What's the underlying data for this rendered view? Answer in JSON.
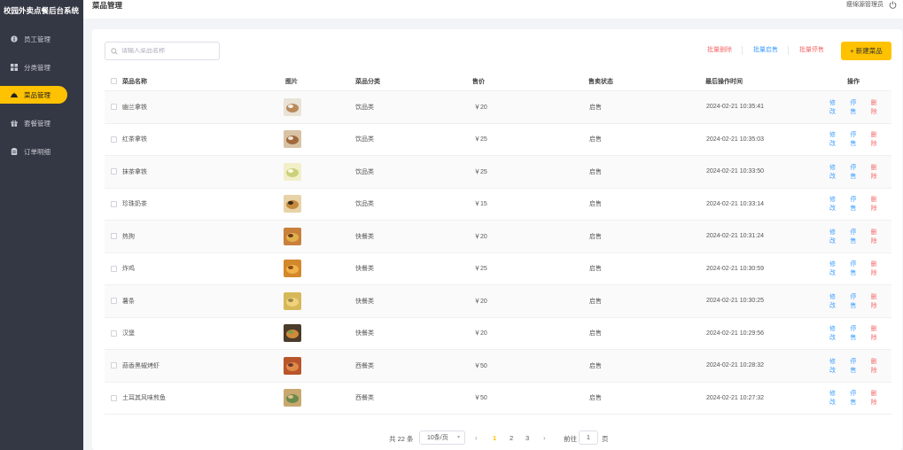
{
  "app": {
    "title": "校园外卖点餐后台系统"
  },
  "sidebar": {
    "items": [
      {
        "label": "员工管理",
        "icon": "info-circle-icon",
        "active": false
      },
      {
        "label": "分类管理",
        "icon": "grid-icon",
        "active": false
      },
      {
        "label": "菜品管理",
        "icon": "dish-cover-icon",
        "active": true
      },
      {
        "label": "套餐管理",
        "icon": "gift-box-icon",
        "active": false
      },
      {
        "label": "订单明细",
        "icon": "clipboard-icon",
        "active": false
      }
    ]
  },
  "header": {
    "title": "菜品管理",
    "user": "瘦绵源管理员",
    "logout_icon": "power-icon"
  },
  "toolbar": {
    "search_placeholder": "请输入菜品名称",
    "batch_delete": "批量删除",
    "batch_enable": "批量启售",
    "batch_disable": "批量停售",
    "new_dish": "+ 新建菜品"
  },
  "table": {
    "columns": [
      "菜品名称",
      "图片",
      "菜品分类",
      "售价",
      "售卖状态",
      "最后操作时间",
      "操作"
    ],
    "rows": [
      {
        "name": "幽兰拿铁",
        "category": "饮品类",
        "price": "￥20",
        "status": "启售",
        "updated": "2024-02-21 10:35:41",
        "edit": "修改",
        "stop": "停售",
        "delete": "删除"
      },
      {
        "name": "红茶拿铁",
        "category": "饮品类",
        "price": "￥25",
        "status": "启售",
        "updated": "2024-02-21 10:35:03",
        "edit": "修改",
        "stop": "停售",
        "delete": "删除"
      },
      {
        "name": "抹茶拿铁",
        "category": "饮品类",
        "price": "￥25",
        "status": "启售",
        "updated": "2024-02-21 10:33:50",
        "edit": "修改",
        "stop": "停售",
        "delete": "删除"
      },
      {
        "name": "珍珠奶茶",
        "category": "饮品类",
        "price": "￥15",
        "status": "启售",
        "updated": "2024-02-21 10:33:14",
        "edit": "修改",
        "stop": "停售",
        "delete": "删除"
      },
      {
        "name": "热狗",
        "category": "快餐类",
        "price": "￥20",
        "status": "启售",
        "updated": "2024-02-21 10:31:24",
        "edit": "修改",
        "stop": "停售",
        "delete": "删除"
      },
      {
        "name": "炸鸡",
        "category": "快餐类",
        "price": "￥25",
        "status": "启售",
        "updated": "2024-02-21 10:30:59",
        "edit": "修改",
        "stop": "停售",
        "delete": "删除"
      },
      {
        "name": "薯条",
        "category": "快餐类",
        "price": "￥20",
        "status": "启售",
        "updated": "2024-02-21 10:30:25",
        "edit": "修改",
        "stop": "停售",
        "delete": "删除"
      },
      {
        "name": "汉堡",
        "category": "快餐类",
        "price": "￥20",
        "status": "启售",
        "updated": "2024-02-21 10:29:56",
        "edit": "修改",
        "stop": "停售",
        "delete": "删除"
      },
      {
        "name": "蒜香黑椒烤虾",
        "category": "西餐类",
        "price": "￥50",
        "status": "启售",
        "updated": "2024-02-21 10:28:32",
        "edit": "修改",
        "stop": "停售",
        "delete": "删除"
      },
      {
        "name": "土耳其风味煎鱼",
        "category": "西餐类",
        "price": "￥50",
        "status": "启售",
        "updated": "2024-02-21 10:27:32",
        "edit": "修改",
        "stop": "停售",
        "delete": "删除"
      }
    ]
  },
  "pagination": {
    "total": "共 22 条",
    "page_size": "10条/页",
    "pages": [
      "1",
      "2",
      "3"
    ],
    "current": "1",
    "goto_label": "前往",
    "goto_value": "1",
    "page_suffix": "页"
  },
  "colors": {
    "accent": "#ffc200",
    "sidebar_bg": "#343744",
    "link": "#409eff",
    "danger": "#f56c6c"
  }
}
